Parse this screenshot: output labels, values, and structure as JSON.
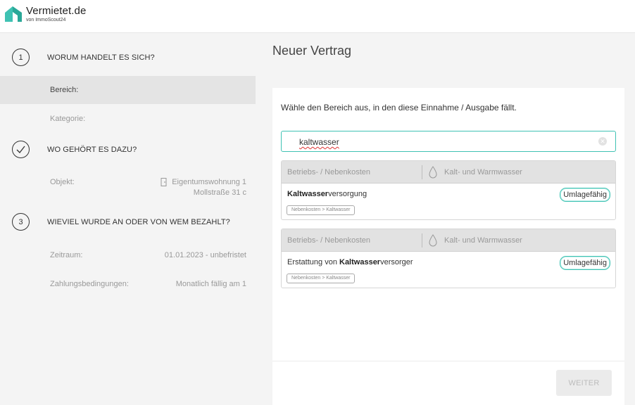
{
  "header": {
    "brand_name": "Vermietet.de",
    "brand_sub": "von ImmoScout24",
    "accent_color": "#3fc2b3"
  },
  "sidebar": {
    "steps": [
      {
        "number": "1",
        "title": "WORUM HANDELT ES SICH?"
      },
      {
        "number": "",
        "icon": "check-icon",
        "title": "WO GEHÖRT ES DAZU?"
      },
      {
        "number": "3",
        "title": "WIEVIEL WURDE AN ODER VON WEM BEZAHLT?"
      }
    ],
    "rows": {
      "bereich": {
        "label": "Bereich:"
      },
      "kategorie": {
        "label": "Kategorie:"
      },
      "objekt": {
        "label": "Objekt:",
        "value_line1": "Eigentumswohnung 1",
        "value_line2": "Mollstraße 31 c",
        "icon": "door-icon"
      },
      "zeitraum": {
        "label": "Zeitraum:",
        "value": "01.01.2023 - unbefristet"
      },
      "zahlung": {
        "label": "Zahlungsbedingungen:",
        "value": "Monatlich fällig am 1"
      }
    }
  },
  "main": {
    "title": "Neuer Vertrag",
    "instruction": "Wähle den Bereich aus, in den diese Einnahme / Ausgabe fällt.",
    "search": {
      "value": "kaltwasser",
      "clear_icon": "clear-icon"
    },
    "results": [
      {
        "category": "Betriebs- / Nebenkosten",
        "subcategory": "Kalt- und Warmwasser",
        "icon": "water-drop-icon",
        "title_prefix": "",
        "title_bold": "Kaltwasser",
        "title_suffix": "versorgung",
        "path": "Nebenkosten > Kaltwasser",
        "badge": "Umlagefähig"
      },
      {
        "category": "Betriebs- / Nebenkosten",
        "subcategory": "Kalt- und Warmwasser",
        "icon": "water-drop-icon",
        "title_prefix": "Erstattung von ",
        "title_bold": "Kaltwasser",
        "title_suffix": "versorger",
        "path": "Nebenkosten > Kaltwasser",
        "badge": "Umlagefähig"
      }
    ],
    "next_button": "WEITER"
  }
}
